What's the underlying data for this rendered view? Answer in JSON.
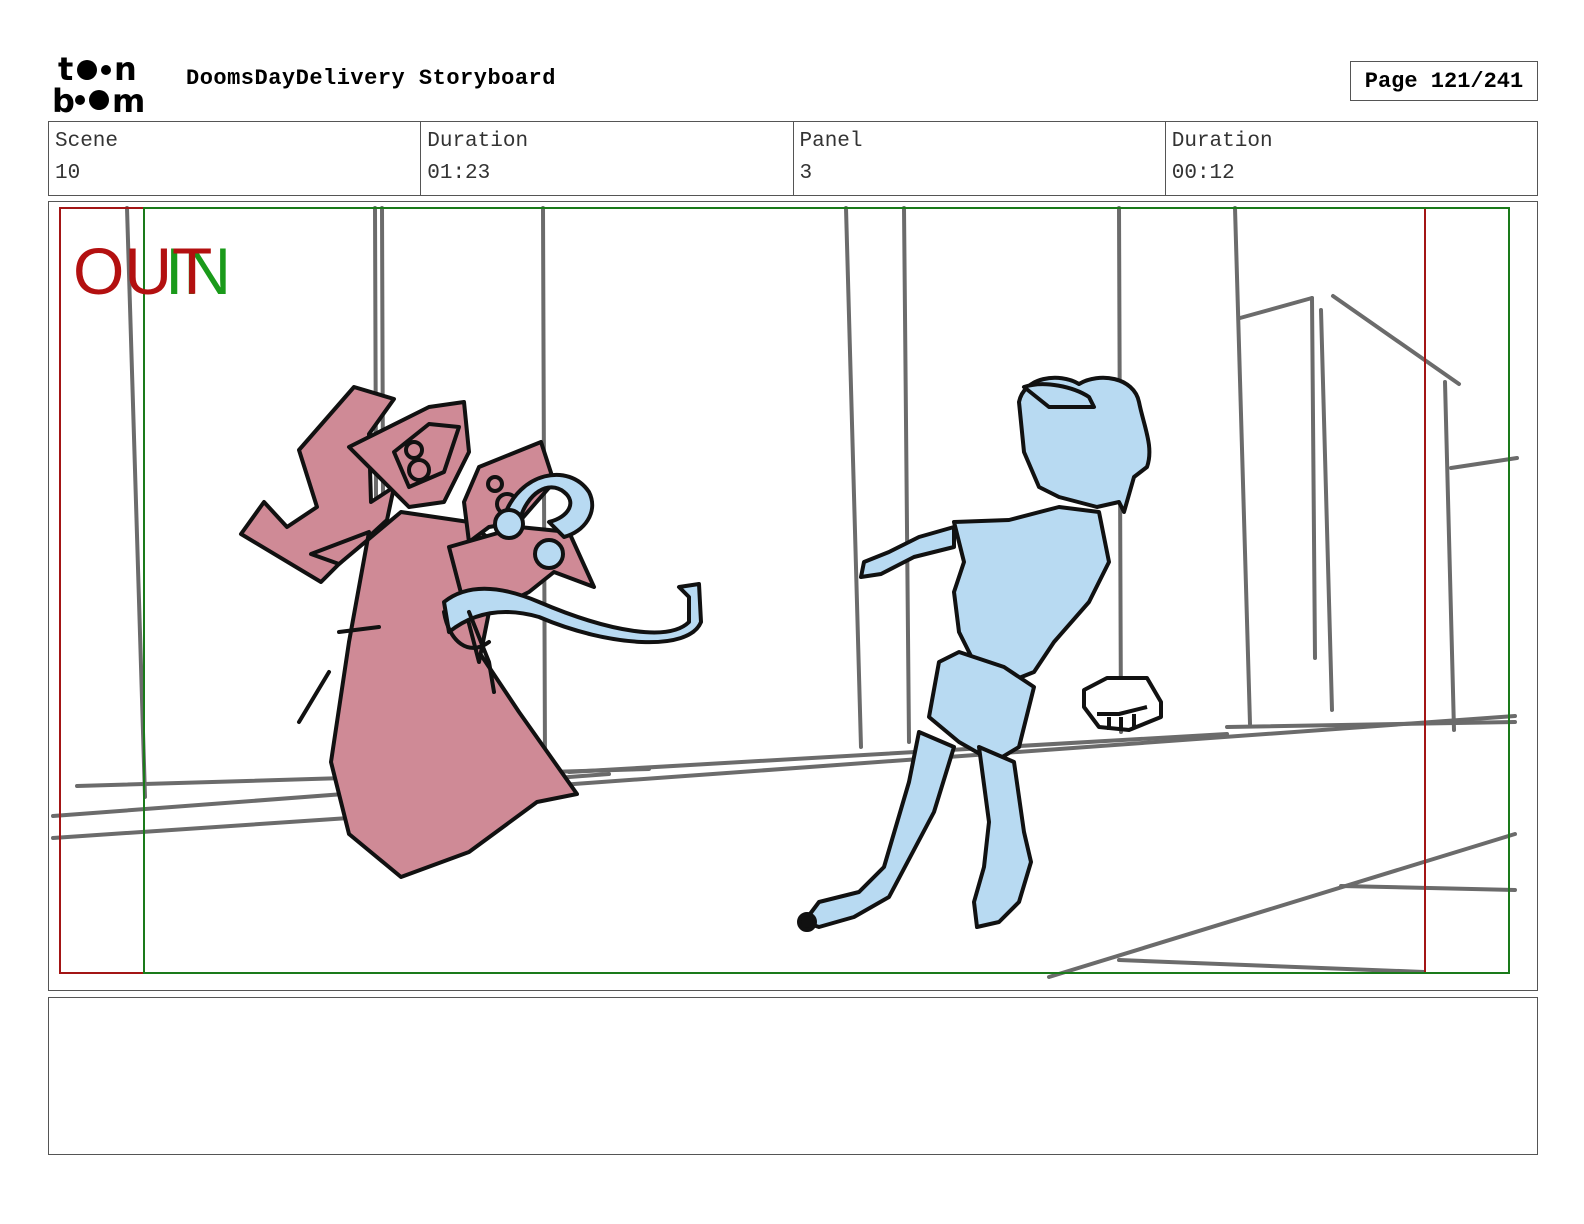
{
  "header": {
    "logo_text": "toon boom",
    "title": "DoomsDayDelivery Storyboard",
    "page": "Page 121/241"
  },
  "info": {
    "scene_label": "Scene",
    "scene_value": "10",
    "scene_duration_label": "Duration",
    "scene_duration_value": "01:23",
    "panel_label": "Panel",
    "panel_value": "3",
    "panel_duration_label": "Duration",
    "panel_duration_value": "00:12"
  },
  "panel": {
    "out_label": "OUT",
    "in_label": "IN",
    "colors": {
      "out_frame": "#a31515",
      "in_frame": "#1a7a1a",
      "figure_pink": "#cf8a96",
      "figure_blue": "#b8daf2",
      "sketch_gray": "#6b6b6b"
    }
  },
  "notes": {
    "text": ""
  }
}
